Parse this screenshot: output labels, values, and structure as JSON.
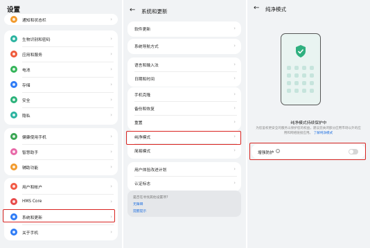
{
  "settings_panel": {
    "title": "设置",
    "top_item": "通知和状态栏",
    "groups": [
      [
        {
          "label": "生物识别和密码",
          "icon": "fingerprint-icon",
          "color": "#2bb3a0"
        },
        {
          "label": "应用和服务",
          "icon": "apps-icon",
          "color": "#ef5a3a"
        },
        {
          "label": "电池",
          "icon": "battery-icon",
          "color": "#35b55a"
        },
        {
          "label": "存储",
          "icon": "storage-icon",
          "color": "#2f7cf6"
        },
        {
          "label": "安全",
          "icon": "security-icon",
          "color": "#2bb27a"
        },
        {
          "label": "隐私",
          "icon": "privacy-icon",
          "color": "#2bb3a0"
        }
      ],
      [
        {
          "label": "健康使用手机",
          "icon": "health-icon",
          "color": "#3aa653"
        },
        {
          "label": "智慧助手",
          "icon": "assistant-icon",
          "color": "#e869a8"
        },
        {
          "label": "辅助功能",
          "icon": "accessibility-icon",
          "color": "#f29b2e"
        }
      ],
      [
        {
          "label": "用户和帐户",
          "icon": "user-icon",
          "color": "#f15a45"
        },
        {
          "label": "HMS Core",
          "icon": "hms-core-icon",
          "color": "#e84b4b"
        },
        {
          "label": "系统和更新",
          "icon": "system-update-icon",
          "color": "#2f7cf6"
        },
        {
          "label": "关于手机",
          "icon": "about-phone-icon",
          "color": "#2f7cf6"
        }
      ]
    ]
  },
  "system_panel": {
    "back_icon": "arrow-left-icon",
    "title": "系统和更新",
    "groups": [
      [
        "软件更新"
      ],
      [
        "系统导航方式"
      ],
      [
        "语言和输入法",
        "日期和时间"
      ],
      [
        "手机克隆",
        "备份和恢复",
        "重置"
      ],
      [
        "纯净模式",
        "简易模式"
      ],
      [
        "用户体验改进计划",
        "认证标志"
      ]
    ],
    "help": {
      "question": "是否在寻找其他设置项?",
      "links": [
        "无障碍",
        "提醒提示"
      ]
    }
  },
  "pure_panel": {
    "back_icon": "arrow-left-icon",
    "title": "纯净模式",
    "status_title": "纯净模式持续保护中",
    "description": "为您鉴权更安全的服务以保护您的权益，建议您关闭部分应用市场以外的应用和网络链接应用。",
    "learn_more": "了解纯净模式",
    "enhanced_label": "增强防护",
    "enhanced_on": false
  },
  "colors": {
    "highlight": "#d9231f",
    "link": "#1e6fe0",
    "shield": "#2fb07f"
  }
}
